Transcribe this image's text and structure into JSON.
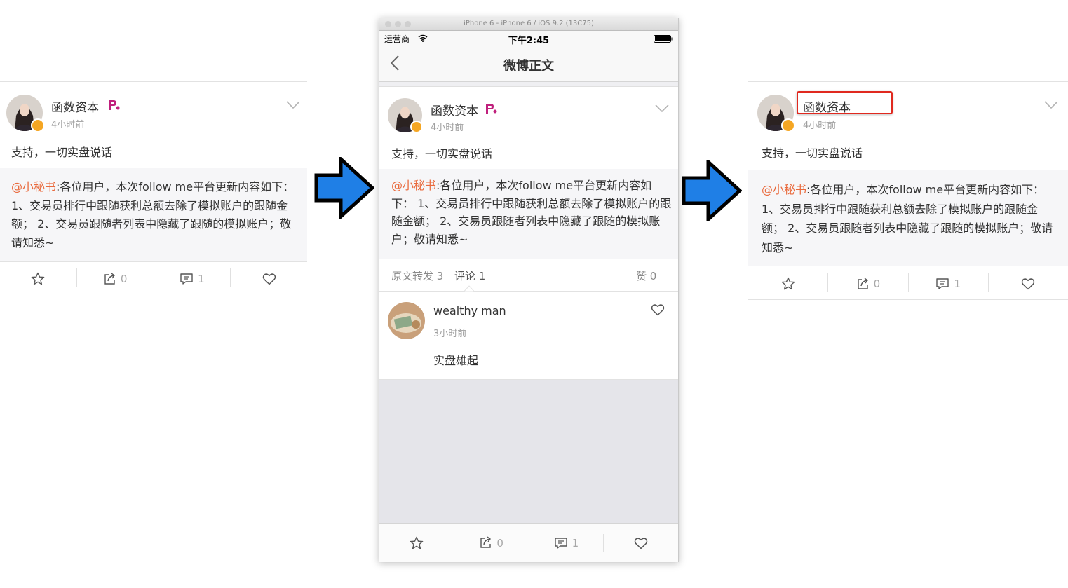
{
  "post": {
    "author": "函数资本",
    "time": "4小时前",
    "text": "支持，一切实盘说话",
    "mention": "@小秘书",
    "repost_body": ":各位用户，本次follow me平台更新内容如下： 1、交易员排行中跟随获利总额去除了模拟账户的跟随金额； 2、交易员跟随者列表中隐藏了跟随的模拟账户；敬请知悉~",
    "share_count": "0",
    "comment_count": "1"
  },
  "phone": {
    "window_title": "iPhone 6 - iPhone 6 / iOS 9.2 (13C75)",
    "carrier": "运营商",
    "clock": "下午2:45",
    "nav_title": "微博正文",
    "tabs": {
      "repost": "原文转发 3",
      "comments": "评论 1",
      "likes": "赞 0"
    },
    "comment": {
      "user": "wealthy man",
      "time": "3小时前",
      "text": "实盘雄起"
    }
  },
  "colors": {
    "accent_orange": "#e96a3d",
    "arrow_blue": "#1f7fe6",
    "highlight_red": "#e0291f"
  }
}
